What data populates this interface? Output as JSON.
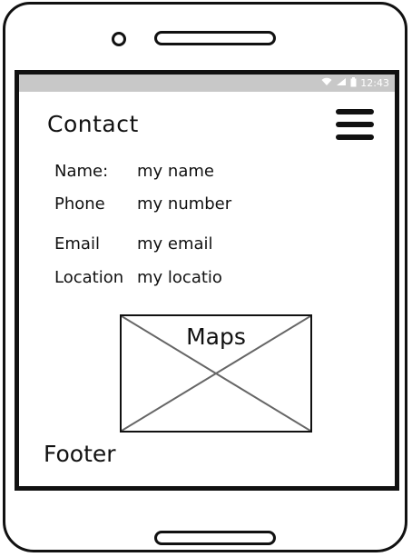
{
  "status_bar": {
    "wifi_icon": "wifi-icon",
    "signal_icon": "signal-icon",
    "battery_icon": "battery-icon",
    "time": "12:43"
  },
  "header": {
    "title": "Contact",
    "menu_icon": "hamburger-menu-icon"
  },
  "contact": {
    "fields": [
      {
        "label": "Name:",
        "value": "my name"
      },
      {
        "label": "Phone",
        "value": "my number"
      },
      {
        "label": "Email",
        "value": "my email"
      },
      {
        "label": "Location",
        "value": "my locatio"
      }
    ]
  },
  "map": {
    "label": "Maps"
  },
  "footer": {
    "label": "Footer"
  }
}
